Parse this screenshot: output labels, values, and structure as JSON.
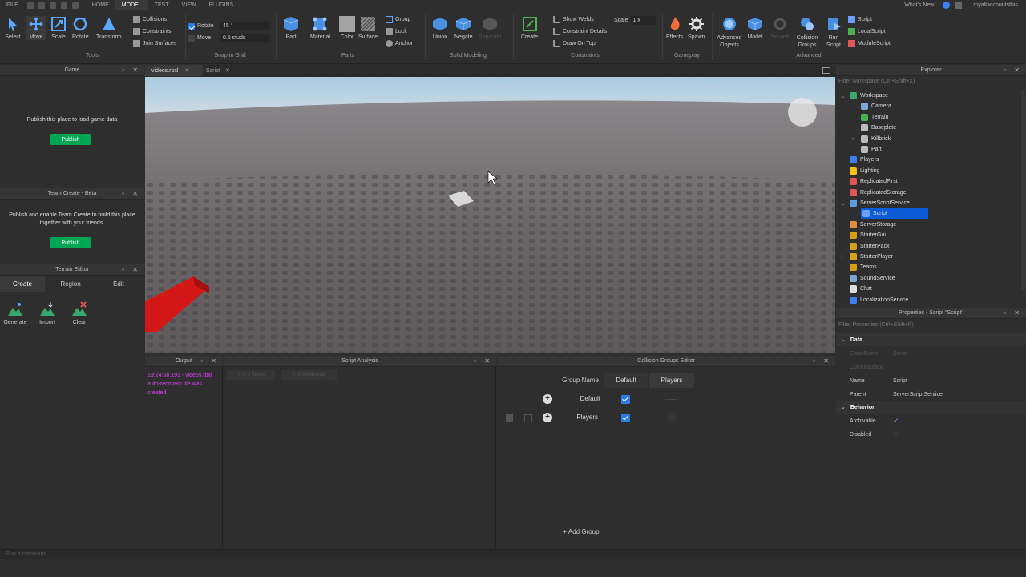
{
  "menu": {
    "file": "FILE",
    "home": "HOME",
    "model": "MODEL",
    "test": "TEST",
    "view": "VIEW",
    "plugins": "PLUGINS",
    "whats_new": "What's New",
    "account": "myaltaccountsthis"
  },
  "tools": {
    "select": "Select",
    "move": "Move",
    "scale": "Scale",
    "rotate": "Rotate",
    "transform": "Transform",
    "collisions": "Collisions",
    "constraints": "Constraints",
    "join_surfaces": "Join Surfaces",
    "group_label": "Tools"
  },
  "snap": {
    "rotate_label": "Rotate",
    "rotate_value": "45 °",
    "move_label": "Move",
    "move_value": "0.5 studs",
    "group_label": "Snap to Grid"
  },
  "parts": {
    "part": "Part",
    "material": "Material",
    "color": "Color",
    "surface": "Surface",
    "group": "Group",
    "lock": "Lock",
    "anchor": "Anchor",
    "group_label": "Parts"
  },
  "solid": {
    "union": "Union",
    "negate": "Negate",
    "separate": "Separate",
    "group_label": "Solid Modeling"
  },
  "constraints": {
    "create": "Create",
    "show_welds": "Show Welds",
    "constraint_details": "Constraint Details",
    "draw_on_top": "Draw On Top",
    "scale_label": "Scale",
    "scale_value": "1 x",
    "group_label": "Constraints"
  },
  "gameplay": {
    "effects": "Effects",
    "spawn": "Spawn",
    "group_label": "Gameplay"
  },
  "advanced": {
    "advanced_objects": "Advanced Objects",
    "model": "Model",
    "service": "Service",
    "collision_groups": "Collision Groups",
    "run_script": "Run Script",
    "script": "Script",
    "local_script": "LocalScript",
    "module_script": "ModuleScript",
    "group_label": "Advanced"
  },
  "game_panel": {
    "title": "Game",
    "message": "Publish this place to load game data",
    "publish": "Publish"
  },
  "team_create": {
    "title": "Team Create - Beta",
    "message": "Publish and enable Team Create to build this place together with your friends.",
    "publish": "Publish"
  },
  "terrain": {
    "title": "Terrain Editor",
    "tabs": [
      "Create",
      "Region",
      "Edit"
    ],
    "generate": "Generate",
    "import": "Import",
    "clear": "Clear"
  },
  "doc_tabs": [
    "videos.rbxl",
    "Script"
  ],
  "output": {
    "title": "Output",
    "message": "19:24:08.191 - videos.rbxl auto-recovery file was created"
  },
  "script_analysis": {
    "title": "Script Analysis",
    "errors": "0 of 0 Errors",
    "warnings": "0 of 0 Warnings"
  },
  "collision": {
    "title": "Collision Groups Editor",
    "col_group": "Group Name",
    "col_default": "Default",
    "col_players": "Players",
    "rows": [
      {
        "name": "Default"
      },
      {
        "name": "Players"
      }
    ],
    "add_group": "+ Add Group"
  },
  "explorer": {
    "title": "Explorer",
    "filter": "Filter workspace (Ctrl+Shift+X)",
    "items": [
      {
        "label": "Workspace",
        "color": "#3aa86b"
      },
      {
        "label": "Camera",
        "color": "#7aa7d8"
      },
      {
        "label": "Terrain",
        "color": "#4caf50"
      },
      {
        "label": "Baseplate",
        "color": "#bbbbbb"
      },
      {
        "label": "Killbrick",
        "color": "#bbbbbb"
      },
      {
        "label": "Part",
        "color": "#bbbbbb"
      },
      {
        "label": "Players",
        "color": "#3b82f6"
      },
      {
        "label": "Lighting",
        "color": "#f5c518"
      },
      {
        "label": "ReplicatedFirst",
        "color": "#e05555"
      },
      {
        "label": "ReplicatedStorage",
        "color": "#e05555"
      },
      {
        "label": "ServerScriptService",
        "color": "#5aa0e0"
      },
      {
        "label": "Script",
        "color": "#6fa0ff"
      },
      {
        "label": "ServerStorage",
        "color": "#e08a3c"
      },
      {
        "label": "StarterGui",
        "color": "#d4a017"
      },
      {
        "label": "StarterPack",
        "color": "#d4a017"
      },
      {
        "label": "StarterPlayer",
        "color": "#d4a017"
      },
      {
        "label": "Teams",
        "color": "#d4a017"
      },
      {
        "label": "SoundService",
        "color": "#7aa7d8"
      },
      {
        "label": "Chat",
        "color": "#dddddd"
      },
      {
        "label": "LocalizationService",
        "color": "#3b82f6"
      }
    ]
  },
  "properties": {
    "title": "Properties - Script \"Script\"",
    "filter": "Filter Properties (Ctrl+Shift+P)",
    "data_section": "Data",
    "class_name_label": "ClassName",
    "class_name_value": "Script",
    "current_editor_label": "CurrentEditor",
    "name_label": "Name",
    "name_value": "Script",
    "parent_label": "Parent",
    "parent_value": "ServerScriptService",
    "behavior_section": "Behavior",
    "archivable_label": "Archivable",
    "disabled_label": "Disabled"
  },
  "command_bar": {
    "placeholder": "Run a command"
  }
}
